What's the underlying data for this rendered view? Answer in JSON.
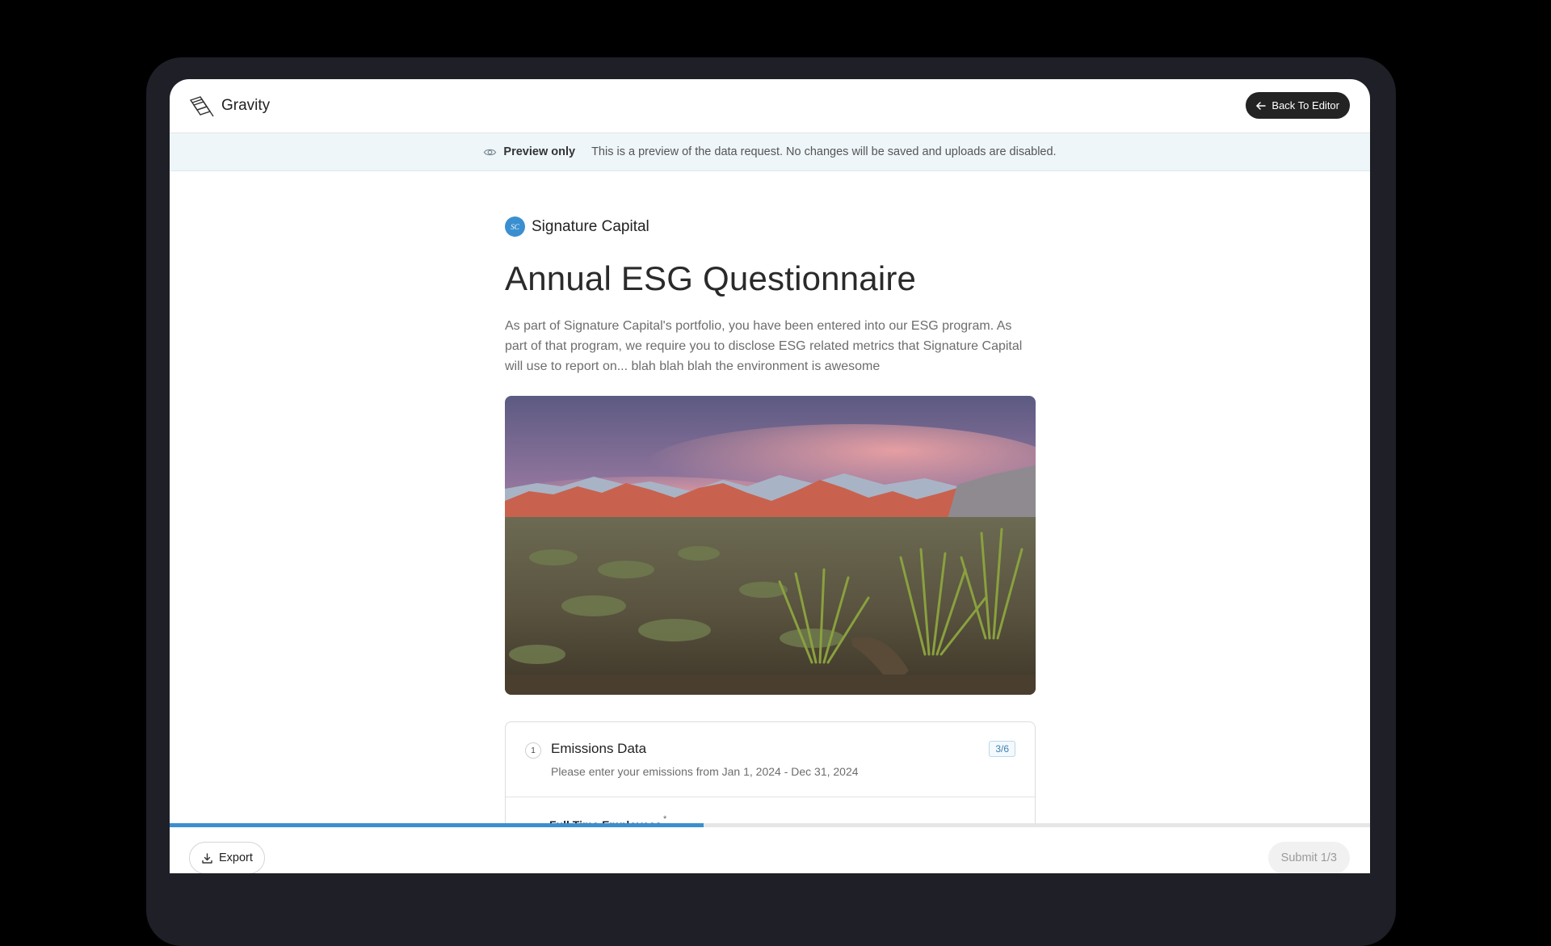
{
  "app": {
    "brand_name": "Gravity",
    "brand_icon": "gravity-logo-icon",
    "back_button_label": "Back To Editor"
  },
  "preview_banner": {
    "tag": "Preview only",
    "message": "This is a preview of the data request. No changes will be saved and uploads are disabled.",
    "icon": "eye-icon"
  },
  "request": {
    "org_initials": "SC",
    "org_name": "Signature Capital",
    "title": "Annual ESG Questionnaire",
    "description": "As part of Signature Capital's portfolio, you have been entered into our ESG program. As part of that program, we require you to disclose ESG related metrics that Signature Capital will use to report on... blah blah blah the environment is awesome"
  },
  "section": {
    "number": "1",
    "title": "Emissions Data",
    "subtitle": "Please enter your emissions from Jan 1, 2024 - Dec 31, 2024",
    "count": "3/6",
    "first_field_label": "Full Time Employees",
    "required_mark": "*"
  },
  "progress": {
    "fraction": 0.445
  },
  "footer": {
    "export_label": "Export",
    "submit_label": "Submit 1/3"
  },
  "colors": {
    "accent": "#3a8fd0",
    "dark_button": "#232323",
    "banner_bg": "#eef6f9"
  }
}
